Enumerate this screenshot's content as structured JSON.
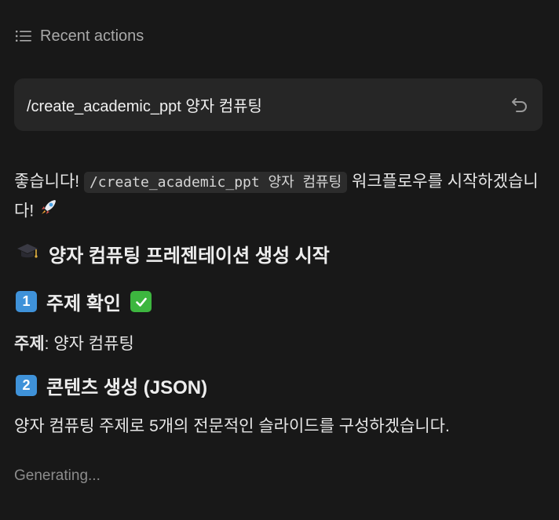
{
  "header": {
    "title": "Recent actions",
    "icon": "list-icon"
  },
  "prompt": {
    "text": "/create_academic_ppt 양자 컴퓨팅",
    "undo_icon": "undo-icon"
  },
  "message": {
    "intro_before": "좋습니다!",
    "intro_code": "/create_academic_ppt 양자 컴퓨팅",
    "intro_after": "워크플로우를 시작하겠습니다!",
    "rocket_icon": "rocket-icon"
  },
  "section_title": {
    "icon": "graduation-cap-icon",
    "text": "양자 컴퓨팅 프레젠테이션 생성 시작"
  },
  "step1": {
    "number": "1",
    "title": "주제 확인",
    "status_icon": "check-icon"
  },
  "topic": {
    "label": "주제",
    "separator": ":",
    "value": "양자 컴퓨팅"
  },
  "step2": {
    "number": "2",
    "title": "콘텐츠 생성 (JSON)"
  },
  "description": "양자 컴퓨팅 주제로 5개의 전문적인 슬라이드를 구성하겠습니다.",
  "status": "Generating...",
  "colors": {
    "background": "#181818",
    "card": "#262626",
    "number_badge": "#3f92d9",
    "check_badge": "#3db63f"
  }
}
